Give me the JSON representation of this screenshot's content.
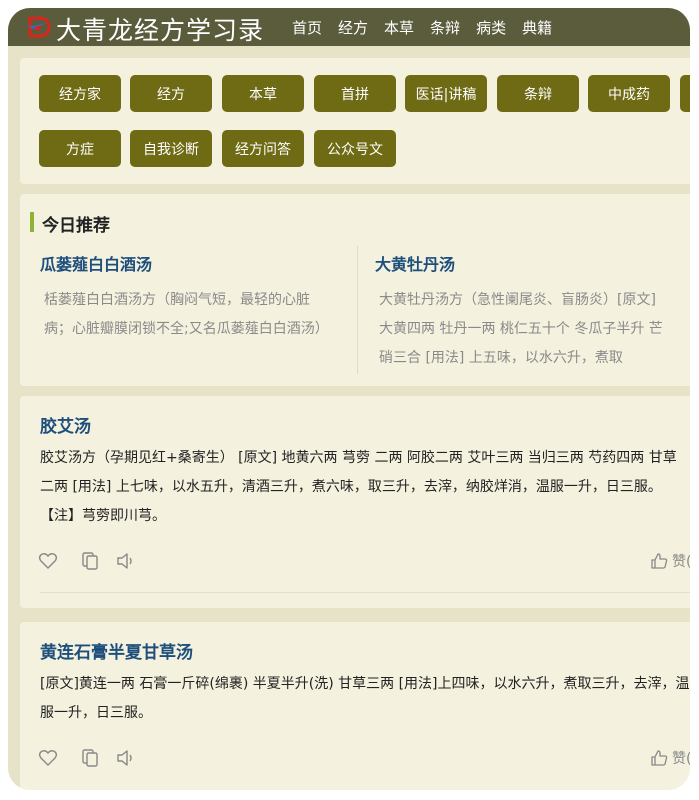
{
  "header": {
    "title": "大青龙经方学习录",
    "nav": [
      "首页",
      "经方",
      "本草",
      "条辩",
      "病类",
      "典籍"
    ]
  },
  "categories": [
    "经方家",
    "经方",
    "本草",
    "首拼",
    "医话|讲稿",
    "条辩",
    "中成药",
    "方症",
    "自我诊断",
    "经方问答",
    "公众号文"
  ],
  "today": {
    "heading": "今日推荐",
    "items": [
      {
        "title": "瓜蒌薤白白酒汤",
        "text": "栝蒌薤白白酒汤方（胸闷气短，最轻的心脏病；心脏瓣膜闭锁不全;又名瓜蒌薤白白酒汤）"
      },
      {
        "title": "大黄牡丹汤",
        "text": "大黄牡丹汤方（急性阑尾炎、盲肠炎）[原文] 大黄四两 牡丹一两 桃仁五十个 冬瓜子半升 芒硝三合 [用法] 上五味，以水六升，煮取"
      }
    ]
  },
  "articles": [
    {
      "title": "胶艾汤",
      "text": "胶艾汤方（孕期见红+桑寄生） [原文] 地黄六两 芎䓖 二两 阿胶二两 艾叶三两 当归三两 芍药四两 甘草二两 [用法] 上七味，以水五升，清酒三升，煮六味，取三升，去滓，纳胶烊消，温服一升，日三服。 【注】芎䓖即川芎。",
      "like_label": "赞()"
    },
    {
      "title": "黄连石膏半夏甘草汤",
      "text": "[原文]黄连一两 石膏一斤碎(绵裹) 半夏半升(洗) 甘草三两 [用法]上四味，以水六升，煮取三升，去滓，温服一升，日三服。",
      "like_label": "赞()"
    }
  ],
  "colors": {
    "header_bg": "#5a5c3c",
    "button_bg": "#6f6a14",
    "title_blue": "#1e4f7c",
    "accent_green": "#8fb339"
  }
}
